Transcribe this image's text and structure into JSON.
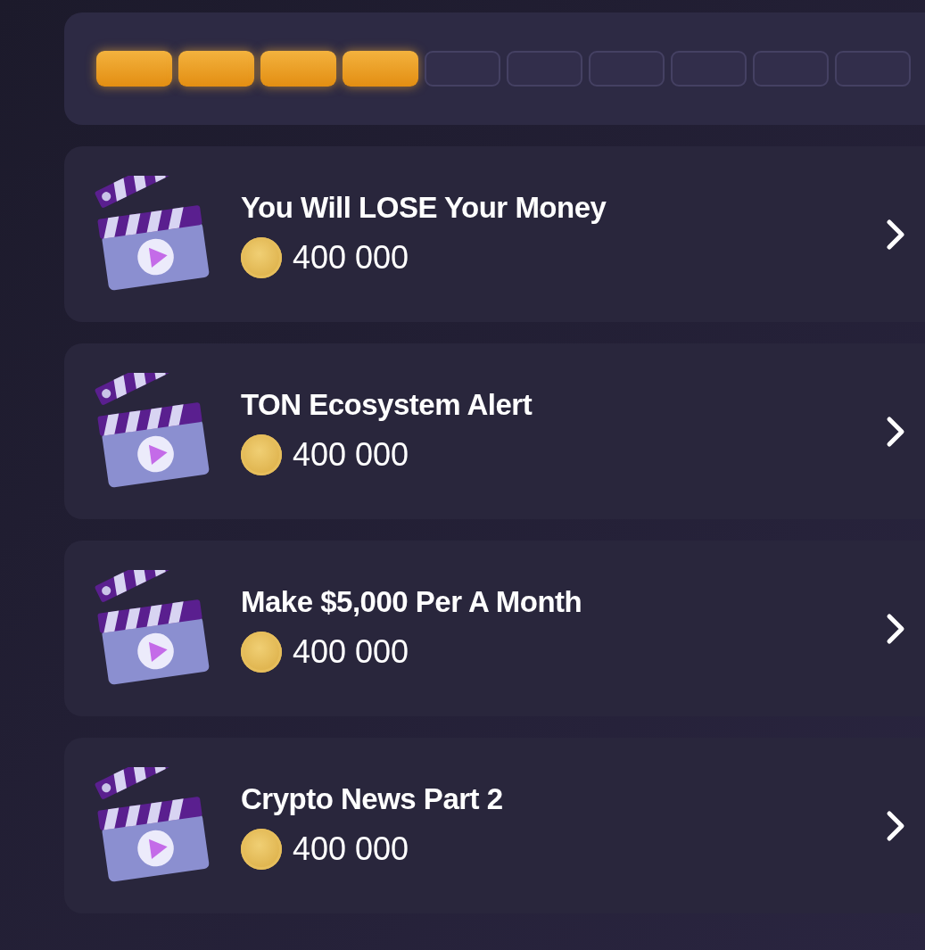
{
  "progress": {
    "segments": [
      {
        "on": true
      },
      {
        "on": true
      },
      {
        "on": true
      },
      {
        "on": true
      },
      {
        "on": false
      },
      {
        "on": false
      },
      {
        "on": false
      },
      {
        "on": false
      },
      {
        "on": false
      },
      {
        "on": false
      }
    ]
  },
  "tasks": [
    {
      "title": "You Will LOSE Your Money",
      "reward": "400 000"
    },
    {
      "title": "TON Ecosystem Alert",
      "reward": "400 000"
    },
    {
      "title": "Make $5,000 Per A Month",
      "reward": "400 000"
    },
    {
      "title": "Crypto News Part 2",
      "reward": "400 000"
    }
  ]
}
